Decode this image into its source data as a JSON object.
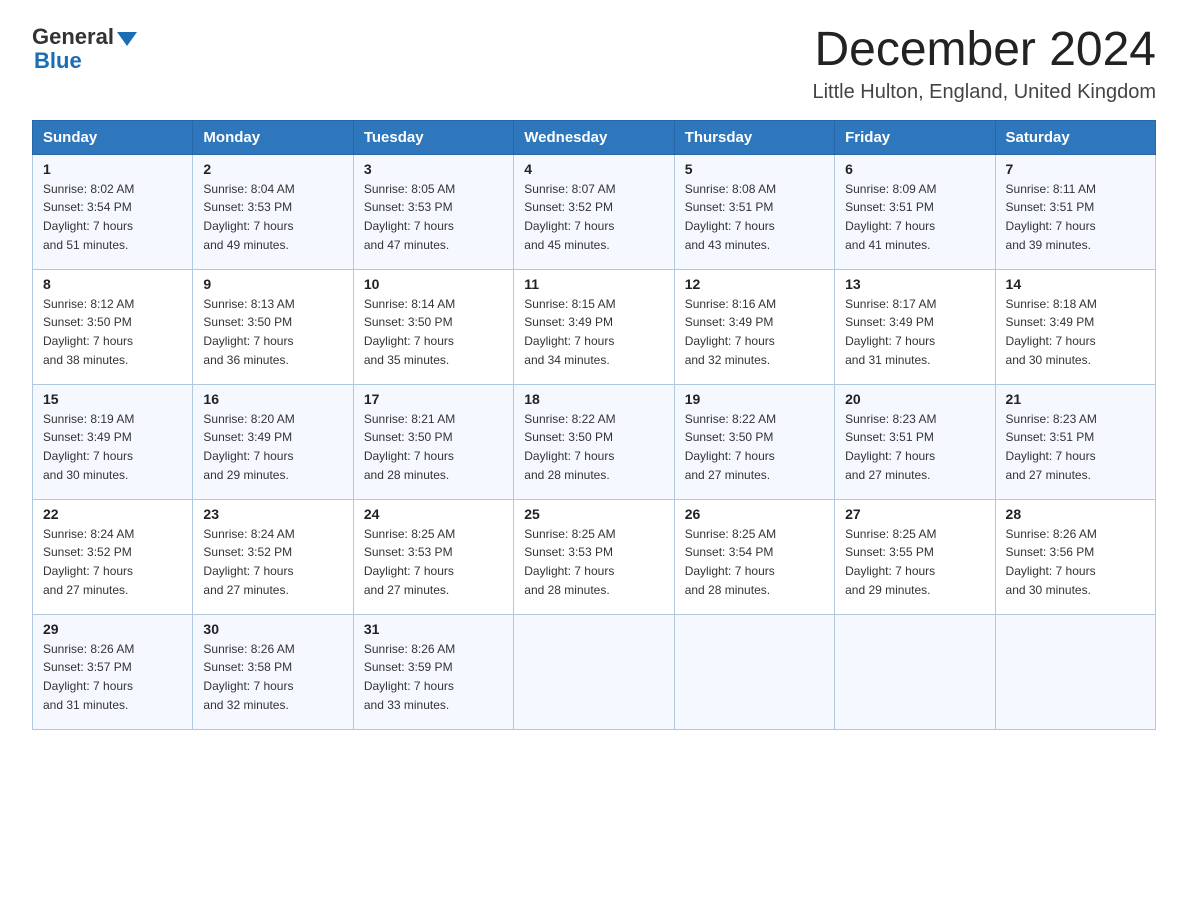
{
  "logo": {
    "text_general": "General",
    "text_blue": "Blue"
  },
  "header": {
    "title": "December 2024",
    "location": "Little Hulton, England, United Kingdom"
  },
  "days_of_week": [
    "Sunday",
    "Monday",
    "Tuesday",
    "Wednesday",
    "Thursday",
    "Friday",
    "Saturday"
  ],
  "weeks": [
    [
      {
        "day": "1",
        "sunrise": "8:02 AM",
        "sunset": "3:54 PM",
        "daylight": "7 hours and 51 minutes."
      },
      {
        "day": "2",
        "sunrise": "8:04 AM",
        "sunset": "3:53 PM",
        "daylight": "7 hours and 49 minutes."
      },
      {
        "day": "3",
        "sunrise": "8:05 AM",
        "sunset": "3:53 PM",
        "daylight": "7 hours and 47 minutes."
      },
      {
        "day": "4",
        "sunrise": "8:07 AM",
        "sunset": "3:52 PM",
        "daylight": "7 hours and 45 minutes."
      },
      {
        "day": "5",
        "sunrise": "8:08 AM",
        "sunset": "3:51 PM",
        "daylight": "7 hours and 43 minutes."
      },
      {
        "day": "6",
        "sunrise": "8:09 AM",
        "sunset": "3:51 PM",
        "daylight": "7 hours and 41 minutes."
      },
      {
        "day": "7",
        "sunrise": "8:11 AM",
        "sunset": "3:51 PM",
        "daylight": "7 hours and 39 minutes."
      }
    ],
    [
      {
        "day": "8",
        "sunrise": "8:12 AM",
        "sunset": "3:50 PM",
        "daylight": "7 hours and 38 minutes."
      },
      {
        "day": "9",
        "sunrise": "8:13 AM",
        "sunset": "3:50 PM",
        "daylight": "7 hours and 36 minutes."
      },
      {
        "day": "10",
        "sunrise": "8:14 AM",
        "sunset": "3:50 PM",
        "daylight": "7 hours and 35 minutes."
      },
      {
        "day": "11",
        "sunrise": "8:15 AM",
        "sunset": "3:49 PM",
        "daylight": "7 hours and 34 minutes."
      },
      {
        "day": "12",
        "sunrise": "8:16 AM",
        "sunset": "3:49 PM",
        "daylight": "7 hours and 32 minutes."
      },
      {
        "day": "13",
        "sunrise": "8:17 AM",
        "sunset": "3:49 PM",
        "daylight": "7 hours and 31 minutes."
      },
      {
        "day": "14",
        "sunrise": "8:18 AM",
        "sunset": "3:49 PM",
        "daylight": "7 hours and 30 minutes."
      }
    ],
    [
      {
        "day": "15",
        "sunrise": "8:19 AM",
        "sunset": "3:49 PM",
        "daylight": "7 hours and 30 minutes."
      },
      {
        "day": "16",
        "sunrise": "8:20 AM",
        "sunset": "3:49 PM",
        "daylight": "7 hours and 29 minutes."
      },
      {
        "day": "17",
        "sunrise": "8:21 AM",
        "sunset": "3:50 PM",
        "daylight": "7 hours and 28 minutes."
      },
      {
        "day": "18",
        "sunrise": "8:22 AM",
        "sunset": "3:50 PM",
        "daylight": "7 hours and 28 minutes."
      },
      {
        "day": "19",
        "sunrise": "8:22 AM",
        "sunset": "3:50 PM",
        "daylight": "7 hours and 27 minutes."
      },
      {
        "day": "20",
        "sunrise": "8:23 AM",
        "sunset": "3:51 PM",
        "daylight": "7 hours and 27 minutes."
      },
      {
        "day": "21",
        "sunrise": "8:23 AM",
        "sunset": "3:51 PM",
        "daylight": "7 hours and 27 minutes."
      }
    ],
    [
      {
        "day": "22",
        "sunrise": "8:24 AM",
        "sunset": "3:52 PM",
        "daylight": "7 hours and 27 minutes."
      },
      {
        "day": "23",
        "sunrise": "8:24 AM",
        "sunset": "3:52 PM",
        "daylight": "7 hours and 27 minutes."
      },
      {
        "day": "24",
        "sunrise": "8:25 AM",
        "sunset": "3:53 PM",
        "daylight": "7 hours and 27 minutes."
      },
      {
        "day": "25",
        "sunrise": "8:25 AM",
        "sunset": "3:53 PM",
        "daylight": "7 hours and 28 minutes."
      },
      {
        "day": "26",
        "sunrise": "8:25 AM",
        "sunset": "3:54 PM",
        "daylight": "7 hours and 28 minutes."
      },
      {
        "day": "27",
        "sunrise": "8:25 AM",
        "sunset": "3:55 PM",
        "daylight": "7 hours and 29 minutes."
      },
      {
        "day": "28",
        "sunrise": "8:26 AM",
        "sunset": "3:56 PM",
        "daylight": "7 hours and 30 minutes."
      }
    ],
    [
      {
        "day": "29",
        "sunrise": "8:26 AM",
        "sunset": "3:57 PM",
        "daylight": "7 hours and 31 minutes."
      },
      {
        "day": "30",
        "sunrise": "8:26 AM",
        "sunset": "3:58 PM",
        "daylight": "7 hours and 32 minutes."
      },
      {
        "day": "31",
        "sunrise": "8:26 AM",
        "sunset": "3:59 PM",
        "daylight": "7 hours and 33 minutes."
      },
      null,
      null,
      null,
      null
    ]
  ],
  "labels": {
    "sunrise": "Sunrise: ",
    "sunset": "Sunset: ",
    "daylight": "Daylight: "
  }
}
